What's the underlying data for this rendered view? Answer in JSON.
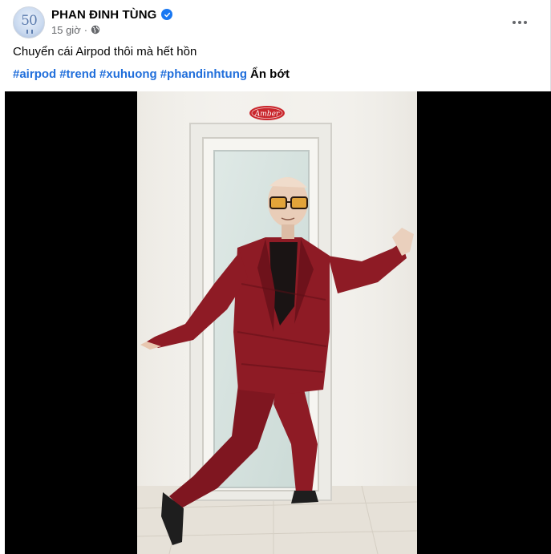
{
  "post": {
    "author": "PHAN ĐINH TÙNG",
    "time": "15 giờ",
    "meta_separator": "·",
    "caption": "Chuyển cái Airpod thôi mà hết hồn",
    "hashtags": [
      "#airpod",
      "#trend",
      "#xuhuong",
      "#phandinhtung"
    ],
    "see_less": "Ẩn bớt",
    "avatar_text": "50",
    "door_sign": "Amber"
  },
  "icons": {
    "verified": "verified-badge-icon",
    "audience": "globe-icon",
    "more": "more-options-icon"
  },
  "colors": {
    "link": "#216fdb",
    "verified": "#1877f2",
    "secondary_text": "#65676b",
    "suit": "#8e1b25"
  }
}
